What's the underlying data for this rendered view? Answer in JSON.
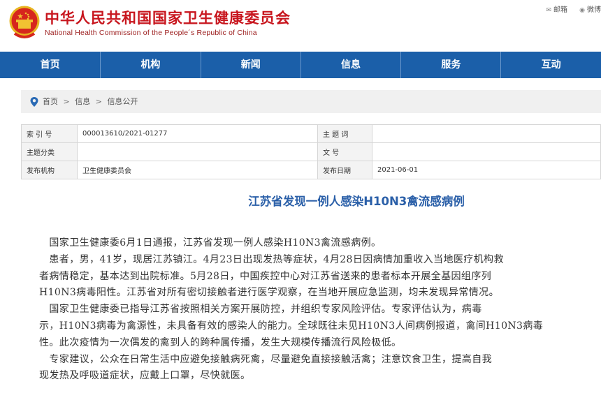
{
  "header": {
    "title": "中华人民共和国国家卫生健康委员会",
    "subtitle": "National Health Commission of the People´s Republic of China",
    "links": [
      {
        "icon": "mail-icon",
        "label": "邮箱"
      },
      {
        "icon": "weibo-icon",
        "label": "微博"
      }
    ]
  },
  "nav": {
    "items": [
      "首页",
      "机构",
      "新闻",
      "信息",
      "服务",
      "互动"
    ]
  },
  "breadcrumb": {
    "icon": "location-pin-icon",
    "items": [
      "首页",
      "信息",
      "信息公开"
    ],
    "separator": ">"
  },
  "meta": {
    "rows": [
      {
        "label1": "索 引 号",
        "value1": "000013610/2021-01277",
        "label2": "主 题 词",
        "value2": ""
      },
      {
        "label1": "主题分类",
        "value1": "",
        "label2": "文    号",
        "value2": ""
      },
      {
        "label1": "发布机构",
        "value1": "卫生健康委员会",
        "label2": "发布日期",
        "value2": "2021-06-01"
      }
    ]
  },
  "article": {
    "title": "江苏省发现一例人感染H10N3禽流感病例",
    "lines": [
      "　国家卫生健康委6月1日通报，江苏省发现一例人感染H10N3禽流感病例。",
      "　患者，男，41岁，现居江苏镇江。4月23日出现发热等症状，4月28日因病情加重收入当地医疗机构救",
      "者病情稳定，基本达到出院标准。5月28日，中国疾控中心对江苏省送来的患者标本开展全基因组序列",
      "H10N3病毒阳性。江苏省对所有密切接触者进行医学观察，在当地开展应急监测，均未发现异常情况。",
      "　国家卫生健康委已指导江苏省按照相关方案开展防控，并组织专家风险评估。专家评估认为，病毒",
      "示，H10N3病毒为禽源性，未具备有效的感染人的能力。全球既往未见H10N3人间病例报道，禽间H10N3病毒",
      "性。此次疫情为一次偶发的禽到人的跨种属传播，发生大规模传播流行风险极低。",
      "　专家建议，公众在日常生活中应避免接触病死禽，尽量避免直接接触活禽；注意饮食卫生，提高自我",
      "现发热及呼吸道症状，应戴上口罩，尽快就医。"
    ]
  },
  "colors": {
    "brand_red": "#c8161e",
    "nav_blue": "#1b5fa9",
    "title_blue": "#2a5fa8"
  }
}
